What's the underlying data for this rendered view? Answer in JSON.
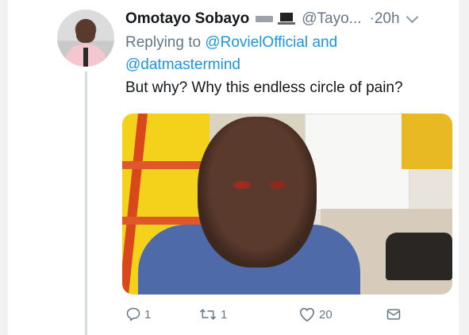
{
  "tweet": {
    "author_name": "Omotayo Sobayo",
    "handle": "@Tayo...",
    "time": "·20h",
    "reply_prefix": "Replying to",
    "reply_mention_1": "@RovielOfficial",
    "reply_and": "and",
    "reply_mention_2": "@datmastermind",
    "text": "But why? Why this endless circle of pain?"
  },
  "actions": {
    "reply_count": "1",
    "retweet_count": "1",
    "like_count": "20"
  },
  "icons": {
    "reply": "reply-icon",
    "retweet": "retweet-icon",
    "like": "heart-icon",
    "dm": "message-icon",
    "more": "chevron-down-icon"
  },
  "colors": {
    "link": "#1b95e0",
    "secondary_text": "#657786",
    "primary_text": "#14171a"
  }
}
